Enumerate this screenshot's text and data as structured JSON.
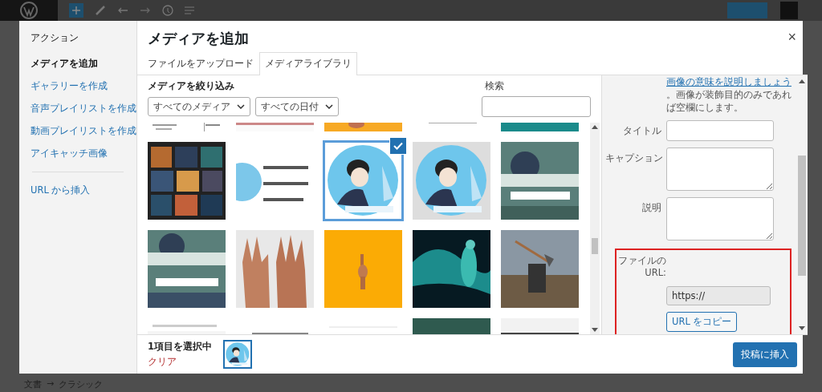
{
  "modal": {
    "title": "メディアを追加",
    "close": "×"
  },
  "menu": [
    {
      "kind": "heading",
      "label": "アクション"
    },
    {
      "kind": "item",
      "label": "メディアを追加",
      "selected": true
    },
    {
      "kind": "item",
      "label": "ギャラリーを作成",
      "selected": false
    },
    {
      "kind": "item",
      "label": "音声プレイリストを作成",
      "selected": false
    },
    {
      "kind": "item",
      "label": "動画プレイリストを作成",
      "selected": false
    },
    {
      "kind": "item",
      "label": "アイキャッチ画像",
      "selected": false
    },
    {
      "kind": "separator"
    },
    {
      "kind": "item",
      "label": "URL から挿入",
      "selected": false
    }
  ],
  "tabs": [
    {
      "label": "ファイルをアップロード",
      "selected": false
    },
    {
      "label": "メディアライブラリ",
      "selected": true
    }
  ],
  "filter": {
    "label": "メディアを絞り込み",
    "selects": [
      "すべてのメディア",
      "すべての日付"
    ],
    "search_label": "検索"
  },
  "media": [
    {
      "selected": false
    },
    {
      "selected": false
    },
    {
      "selected": false
    },
    {
      "selected": false
    },
    {
      "selected": false
    },
    {
      "selected": false
    },
    {
      "selected": false
    },
    {
      "selected": true
    },
    {
      "selected": false
    },
    {
      "selected": false
    },
    {
      "selected": false
    },
    {
      "selected": false
    },
    {
      "selected": false
    },
    {
      "selected": false
    },
    {
      "selected": false
    },
    {
      "selected": false
    },
    {
      "selected": false
    },
    {
      "selected": false
    },
    {
      "selected": false
    },
    {
      "selected": false
    }
  ],
  "details": {
    "alt_help_link": "画像の意味を説明しましょう",
    "alt_help_text": "。画像が装飾目的のみであれば空欄にします。",
    "fields": [
      {
        "kind": "text",
        "label": "タイトル"
      },
      {
        "kind": "textarea",
        "label": "キャプション"
      },
      {
        "kind": "textarea",
        "label": "説明"
      }
    ],
    "url_label": [
      "ファイルの",
      "URL:"
    ],
    "url_value": "https://",
    "copy_button": "URL をコピー"
  },
  "footer": {
    "selection": "1項目を選択中",
    "clear": "クリア",
    "insert_button": "投稿に挿入"
  },
  "breadcrumb": [
    "文書",
    "→",
    "クラシック"
  ]
}
